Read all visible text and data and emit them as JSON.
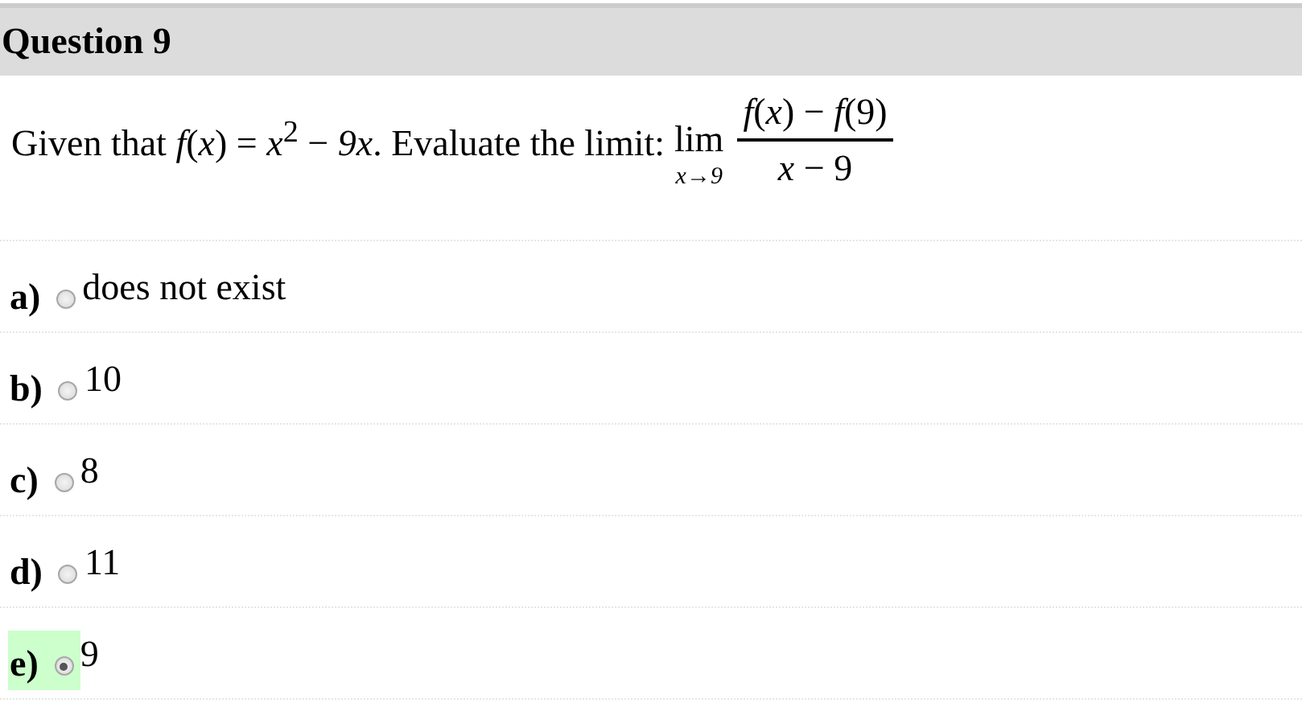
{
  "question": {
    "title": "Question 9"
  },
  "prompt": {
    "text": "Given that *f*(*x*) = *x*$^{2}$ − *9x*. Evaluate the limit:",
    "limit": {
      "operator": "lim",
      "subscript": "x→9",
      "numerator": "*f*(*x*) − *f*(9)",
      "denominator": "*x* − 9"
    }
  },
  "options": [
    {
      "label": "a)",
      "text": "does not exist",
      "selected": false
    },
    {
      "label": "b)",
      "text": "10",
      "selected": false
    },
    {
      "label": "c)",
      "text": "8",
      "selected": false
    },
    {
      "label": "d)",
      "text": "11",
      "selected": false
    },
    {
      "label": "e)",
      "text": "9",
      "selected": true
    }
  ]
}
